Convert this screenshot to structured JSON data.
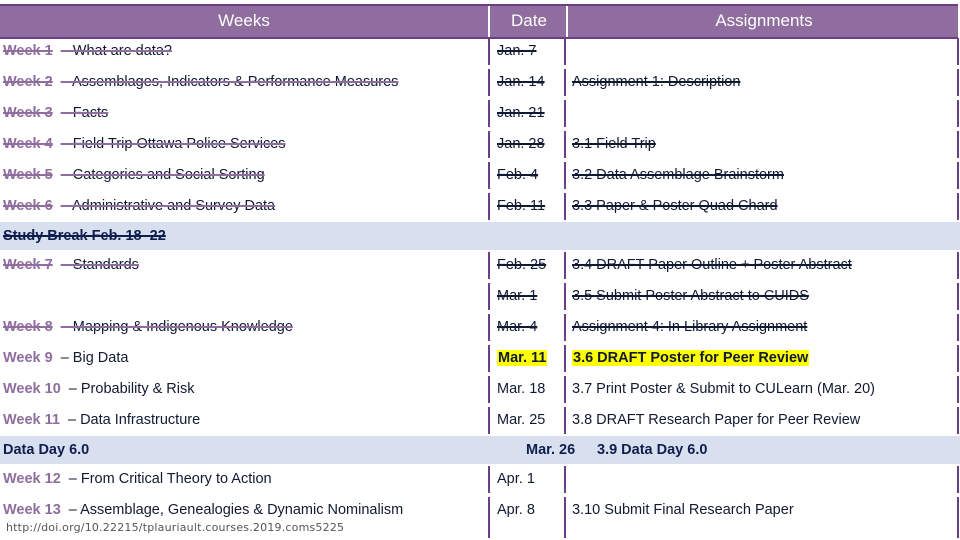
{
  "header": {
    "weeks": "Weeks",
    "date": "Date",
    "assignments": "Assignments"
  },
  "colors": {
    "header_bg": "#8f6d9e",
    "border": "#6b3f86",
    "band_bg": "#d8e0f0",
    "highlight": "#ffff00",
    "week_label": "#8f6d9e",
    "text": "#111a33"
  },
  "rows": [
    {
      "week": "Week 1",
      "topic": "– What are data?",
      "date": "Jan. 7",
      "assignment": "",
      "done": true
    },
    {
      "week": "Week 2",
      "topic": "– Assemblages, Indicators & Performance Measures",
      "date": "Jan. 14",
      "assignment": "Assignment 1: Description",
      "done": true
    },
    {
      "week": "Week 3",
      "topic": "– Facts",
      "date": "Jan. 21",
      "assignment": "",
      "done": true
    },
    {
      "week": "Week 4",
      "topic": "– Field Trip Ottawa Police Services",
      "date": "Jan. 28",
      "assignment": "3.1 Field Trip",
      "done": true
    },
    {
      "week": "Week 5",
      "topic": "– Categories and Social Sorting",
      "date": "Feb. 4",
      "assignment": "3.2 Data Assemblage Brainstorm",
      "done": true
    },
    {
      "week": "Week 6",
      "topic": "– Administrative and Survey Data",
      "date": "Feb. 11",
      "assignment": "3.3 Paper & Poster Quad Chard",
      "done": true
    },
    {
      "band": true,
      "label": "Study Break Feb. 18–22",
      "done": true
    },
    {
      "week": "Week 7",
      "topic": "– Standards",
      "date": "Feb. 25",
      "assignment": "3.4 DRAFT Paper Outline + Poster Abstract",
      "done": true
    },
    {
      "week": "",
      "topic": "",
      "date": "Mar. 1",
      "assignment": "3.5 Submit Poster Abstract to CUIDS",
      "done": true
    },
    {
      "week": "Week 8",
      "topic": "– Mapping & Indigenous Knowledge",
      "date": "Mar. 4",
      "assignment": "Assignment 4: In Library Assignment",
      "done": true
    },
    {
      "week": "Week 9",
      "topic": "– Big Data",
      "date": "Mar. 11",
      "assignment": "3.6 DRAFT Poster for Peer Review",
      "done": false,
      "highlight": true
    },
    {
      "week": "Week 10",
      "topic": "– Probability & Risk",
      "date": "Mar. 18",
      "assignment": "3.7 Print Poster & Submit to CULearn (Mar. 20)",
      "done": false
    },
    {
      "week": "Week 11",
      "topic": "– Data Infrastructure",
      "date": "Mar. 25",
      "assignment": "3.8 DRAFT Research Paper for Peer Review",
      "done": false
    },
    {
      "band": true,
      "label": "Data Day 6.0",
      "date": "Mar. 26",
      "assignment": "3.9 Data Day 6.0",
      "done": false
    },
    {
      "week": "Week 12",
      "topic": "– From Critical Theory to Action",
      "date": "Apr. 1",
      "assignment": "",
      "done": false
    },
    {
      "week": "Week 13",
      "topic": "– Assemblage, Genealogies & Dynamic Nominalism",
      "date": "Apr. 8",
      "assignment": "3.10 Submit Final Research Paper",
      "done": false
    }
  ],
  "footer": {
    "doi": "http://doi.org/10.22215/tplauriault.courses.2019.coms5225"
  }
}
